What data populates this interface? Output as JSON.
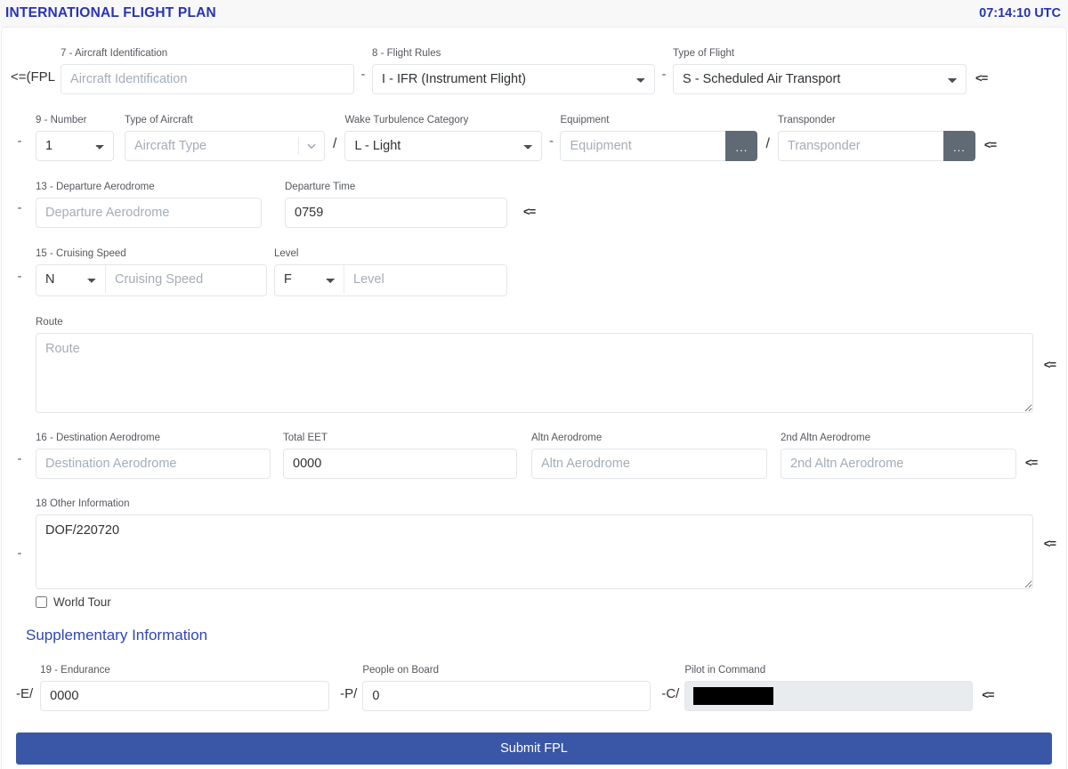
{
  "header": {
    "title": "INTERNATIONAL FLIGHT PLAN",
    "clock": "07:14:10 UTC"
  },
  "marks": {
    "arrow": "<=",
    "dash": "-",
    "slash": "/",
    "fpl_prefix": "<=(FPL",
    "dots": "...",
    "endurance_prefix": "-E/",
    "people_prefix": "-P/",
    "pilot_prefix": "-C/"
  },
  "fields": {
    "aircraft_identification": {
      "label": "7 - Aircraft Identification",
      "placeholder": "Aircraft Identification",
      "value": ""
    },
    "flight_rules": {
      "label": "8 - Flight Rules",
      "selected": "I - IFR (Instrument Flight)",
      "options": [
        "I - IFR (Instrument Flight)"
      ]
    },
    "type_of_flight": {
      "label": "Type of Flight",
      "selected": "S - Scheduled Air Transport",
      "options": [
        "S - Scheduled Air Transport"
      ]
    },
    "number": {
      "label": "9 - Number",
      "selected": "1",
      "options": [
        "1"
      ]
    },
    "type_of_aircraft": {
      "label": "Type of Aircraft",
      "placeholder": "Aircraft Type",
      "value": ""
    },
    "wake_turbulence": {
      "label": "Wake Turbulence Category",
      "selected": "L - Light",
      "options": [
        "L - Light"
      ]
    },
    "equipment": {
      "label": "Equipment",
      "placeholder": "Equipment",
      "value": ""
    },
    "transponder": {
      "label": "Transponder",
      "placeholder": "Transponder",
      "value": ""
    },
    "departure_aerodrome": {
      "label": "13 - Departure Aerodrome",
      "placeholder": "Departure Aerodrome",
      "value": ""
    },
    "departure_time": {
      "label": "Departure Time",
      "placeholder": "",
      "value": "0759"
    },
    "cruising_speed": {
      "label": "15 - Cruising Speed",
      "unit_selected": "N",
      "unit_options": [
        "N"
      ],
      "placeholder": "Cruising Speed",
      "value": ""
    },
    "level": {
      "label": "Level",
      "unit_selected": "F",
      "unit_options": [
        "F"
      ],
      "placeholder": "Level",
      "value": ""
    },
    "route": {
      "label": "Route",
      "placeholder": "Route",
      "value": ""
    },
    "destination_aerodrome": {
      "label": "16 - Destination Aerodrome",
      "placeholder": "Destination Aerodrome",
      "value": ""
    },
    "total_eet": {
      "label": "Total EET",
      "placeholder": "",
      "value": "0000"
    },
    "altn_aerodrome": {
      "label": "Altn Aerodrome",
      "placeholder": "Altn Aerodrome",
      "value": ""
    },
    "altn2_aerodrome": {
      "label": "2nd Altn Aerodrome",
      "placeholder": "2nd Altn Aerodrome",
      "value": ""
    },
    "other_information": {
      "label": "18 Other Information",
      "placeholder": "",
      "value": "DOF/220720"
    },
    "world_tour": {
      "label": "World Tour",
      "checked": false
    },
    "endurance": {
      "label": "19 - Endurance",
      "placeholder": "",
      "value": "0000"
    },
    "people_on_board": {
      "label": "People on Board",
      "placeholder": "",
      "value": "0"
    },
    "pilot_in_command": {
      "label": "Pilot in Command",
      "placeholder": "",
      "value": ""
    }
  },
  "sections": {
    "supplementary": "Supplementary Information"
  },
  "submit": {
    "label": "Submit FPL"
  },
  "colors": {
    "accent": "#2734b6",
    "submit_bg": "#3a56a6",
    "dots_button": "#5f6a75",
    "border": "#e3e6ea"
  }
}
